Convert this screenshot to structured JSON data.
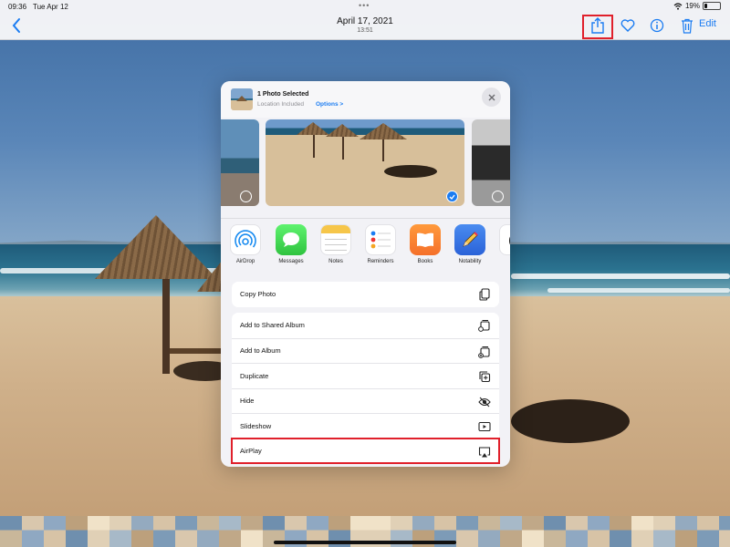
{
  "status": {
    "time": "09:36",
    "date": "Tue Apr 12",
    "battery": "19%"
  },
  "nav": {
    "title": "April 17, 2021",
    "subtitle": "13:51",
    "edit": "Edit"
  },
  "sheet": {
    "header": {
      "title": "1 Photo Selected",
      "subtitle": "Location Included",
      "options": "Options >"
    },
    "apps": [
      {
        "label": "AirDrop",
        "icon": "airdrop-icon"
      },
      {
        "label": "Messages",
        "icon": "messages-icon"
      },
      {
        "label": "Notes",
        "icon": "notes-icon"
      },
      {
        "label": "Reminders",
        "icon": "reminders-icon"
      },
      {
        "label": "Books",
        "icon": "books-icon"
      },
      {
        "label": "Notability",
        "icon": "notability-icon"
      }
    ],
    "actions_group1": [
      {
        "label": "Copy Photo",
        "icon": "copy-icon"
      }
    ],
    "actions_group2": [
      {
        "label": "Add to Shared Album",
        "icon": "shared-album-icon"
      },
      {
        "label": "Add to Album",
        "icon": "album-icon"
      },
      {
        "label": "Duplicate",
        "icon": "duplicate-icon"
      },
      {
        "label": "Hide",
        "icon": "eye-icon"
      },
      {
        "label": "Slideshow",
        "icon": "play-icon"
      },
      {
        "label": "AirPlay",
        "icon": "airplay-icon"
      }
    ]
  },
  "colors": {
    "accent": "#1a7cf2",
    "highlight": "#e0202b",
    "sheet_bg": "#f2f2f6"
  }
}
